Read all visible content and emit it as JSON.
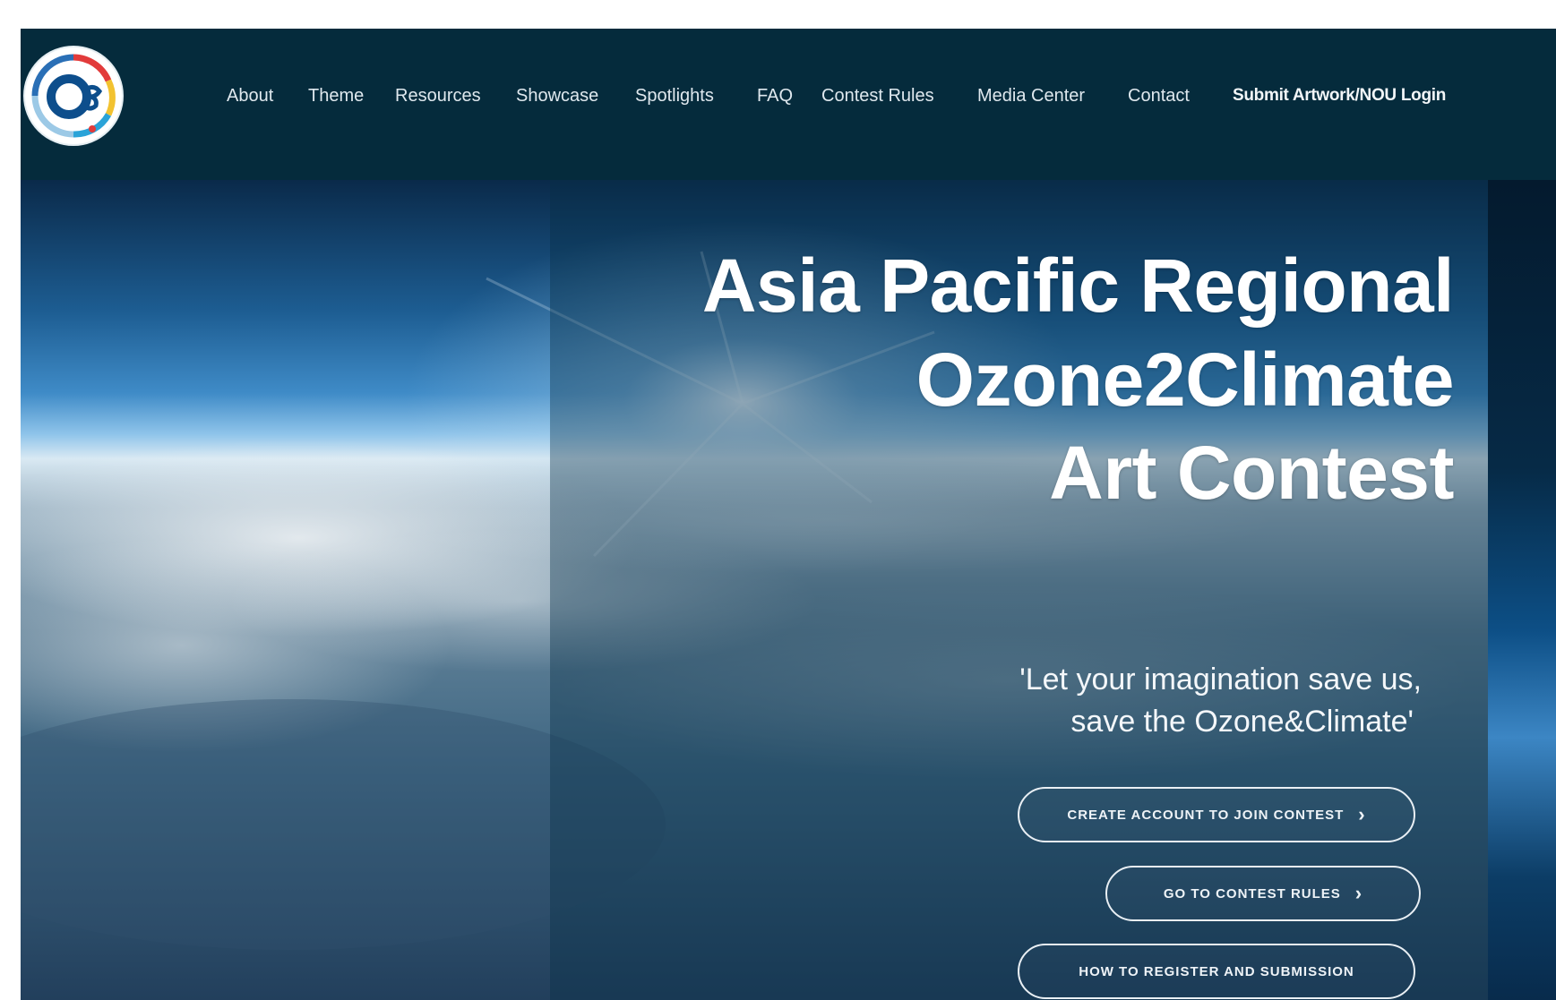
{
  "header": {
    "logo_icon": "o3-contest-logo-icon",
    "nav": [
      {
        "label": "About"
      },
      {
        "label": "Theme"
      },
      {
        "label": "Resources"
      },
      {
        "label": "Showcase"
      },
      {
        "label": "Spotlights"
      },
      {
        "label": "FAQ"
      },
      {
        "label": "Contest Rules"
      },
      {
        "label": "Media Center"
      },
      {
        "label": "Contact"
      }
    ],
    "submit_label": "Submit Artwork/NOU Login"
  },
  "hero": {
    "title_lines": [
      "Asia Pacific Regional",
      "Ozone2Climate",
      "Art Contest"
    ],
    "quote_lines": [
      "'Let your imagination save us,",
      "save the Ozone&Climate'"
    ],
    "buttons": [
      {
        "label": "CREATE ACCOUNT TO JOIN CONTEST",
        "icon": "chevron-right-icon"
      },
      {
        "label": "GO TO CONTEST RULES",
        "icon": "chevron-right-icon"
      },
      {
        "label": "HOW TO REGISTER AND SUBMISSION"
      }
    ],
    "chevron_glyph": "›"
  },
  "colors": {
    "header_bg": "#052b3c",
    "text_light": "#ffffff",
    "button_border": "#e9eff4"
  }
}
